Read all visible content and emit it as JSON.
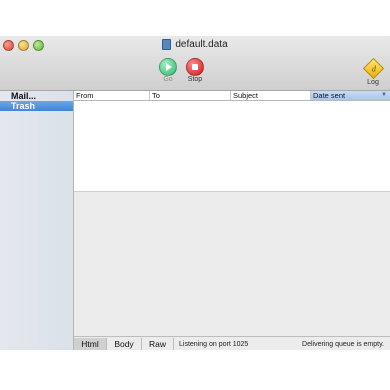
{
  "window": {
    "title": "default.data"
  },
  "toolbar": {
    "go_label": "Go",
    "stop_label": "Stop",
    "log_label": "Log",
    "log_glyph": "d"
  },
  "sidebar": {
    "items": [
      {
        "label": "Mail..."
      },
      {
        "label": "Trash",
        "selected": true
      }
    ]
  },
  "list": {
    "columns": [
      "From",
      "To",
      "Subject",
      "Date sent"
    ],
    "sort_arrow": "▼"
  },
  "statusbar": {
    "tabs": [
      "Html",
      "Body",
      "Raw"
    ],
    "listening": "Listening on port 1025",
    "queue": "Delivering queue is empty."
  },
  "colors": {
    "selection": "#3f86db",
    "go": "#35b772",
    "stop": "#d0161a"
  }
}
